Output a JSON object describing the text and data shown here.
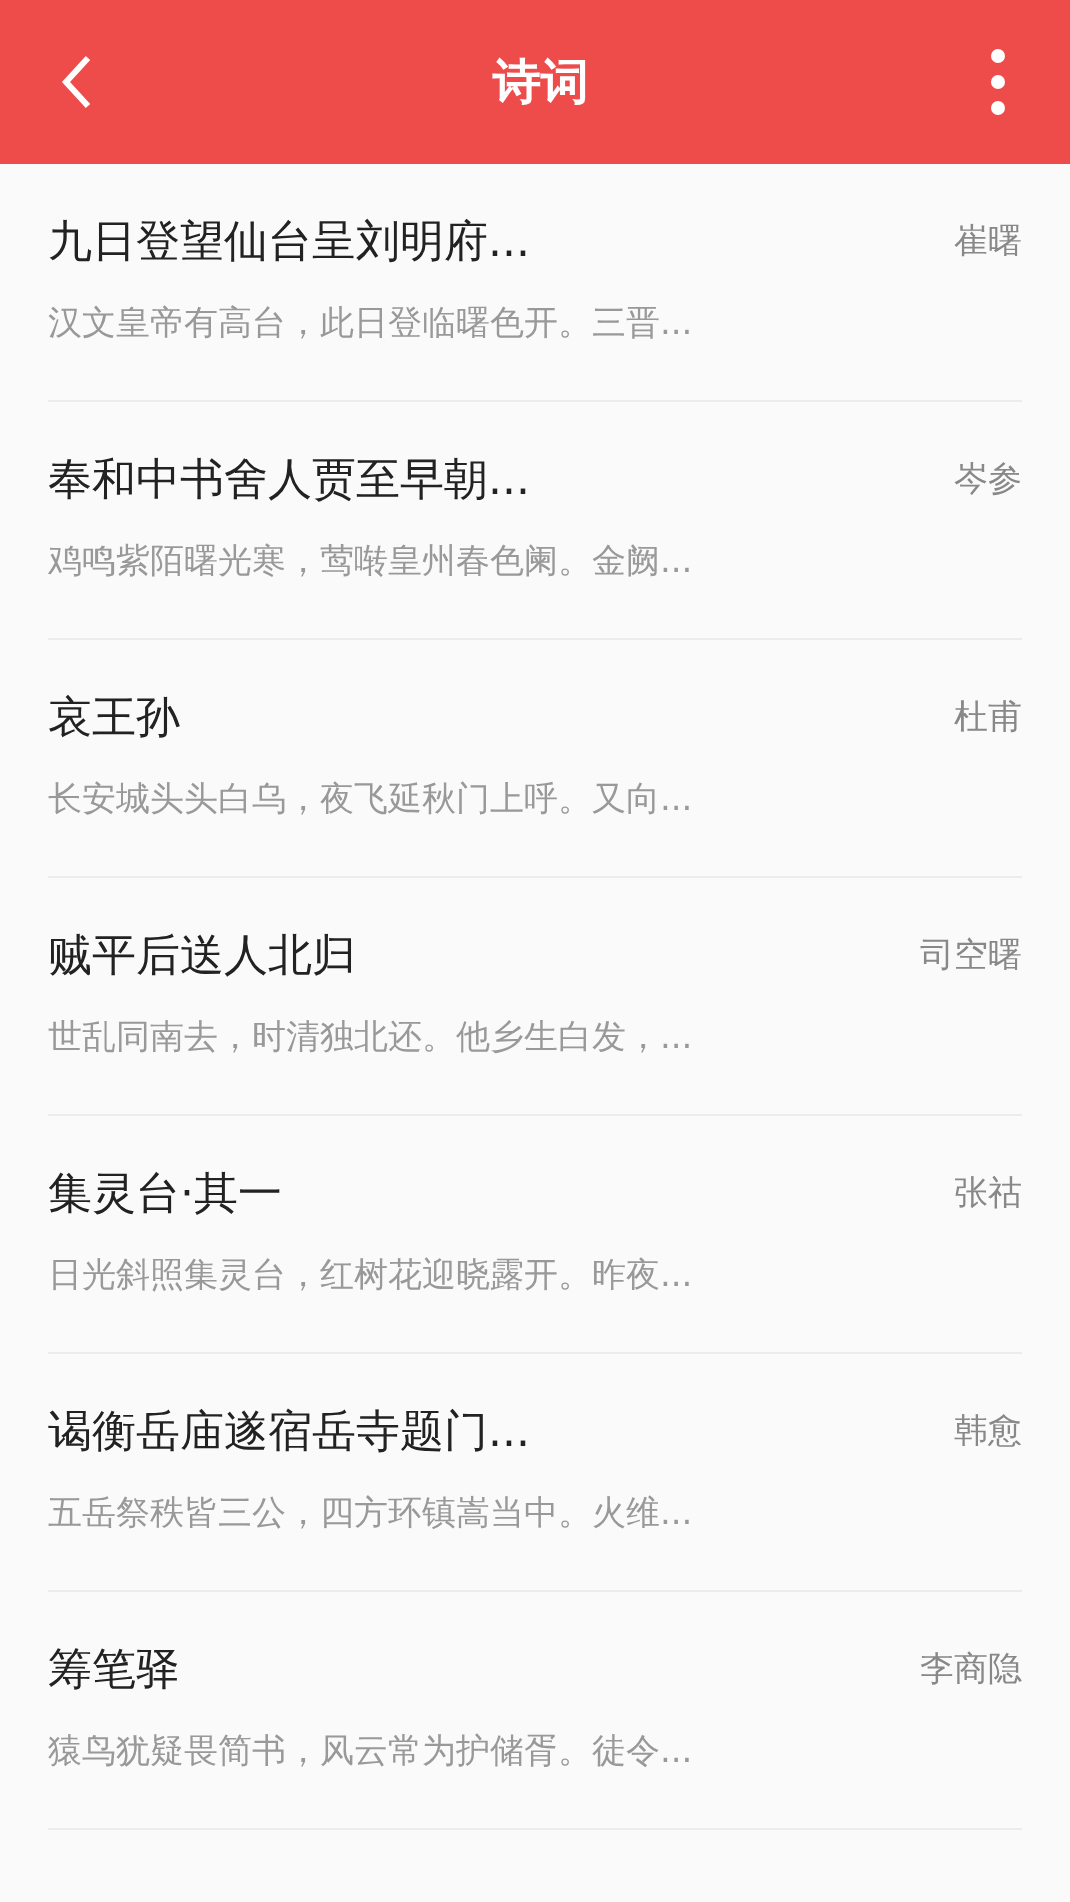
{
  "header": {
    "title": "诗词"
  },
  "poems": [
    {
      "title": "九日登望仙台呈刘明府...",
      "author": "崔曙",
      "excerpt": "汉文皇帝有高台，此日登临曙色开。三晋..."
    },
    {
      "title": "奉和中书舍人贾至早朝...",
      "author": "岑参",
      "excerpt": "鸡鸣紫陌曙光寒，莺啭皇州春色阑。金阙..."
    },
    {
      "title": "哀王孙",
      "author": "杜甫",
      "excerpt": "长安城头头白乌，夜飞延秋门上呼。又向..."
    },
    {
      "title": "贼平后送人北归",
      "author": "司空曙",
      "excerpt": "世乱同南去，时清独北还。他乡生白发，..."
    },
    {
      "title": "集灵台·其一",
      "author": "张祜",
      "excerpt": "日光斜照集灵台，红树花迎晓露开。昨夜..."
    },
    {
      "title": "谒衡岳庙遂宿岳寺题门...",
      "author": "韩愈",
      "excerpt": "五岳祭秩皆三公，四方环镇嵩当中。火维..."
    },
    {
      "title": "筹笔驿",
      "author": "李商隐",
      "excerpt": "猿鸟犹疑畏简书，风云常为护储胥。徒令..."
    }
  ]
}
